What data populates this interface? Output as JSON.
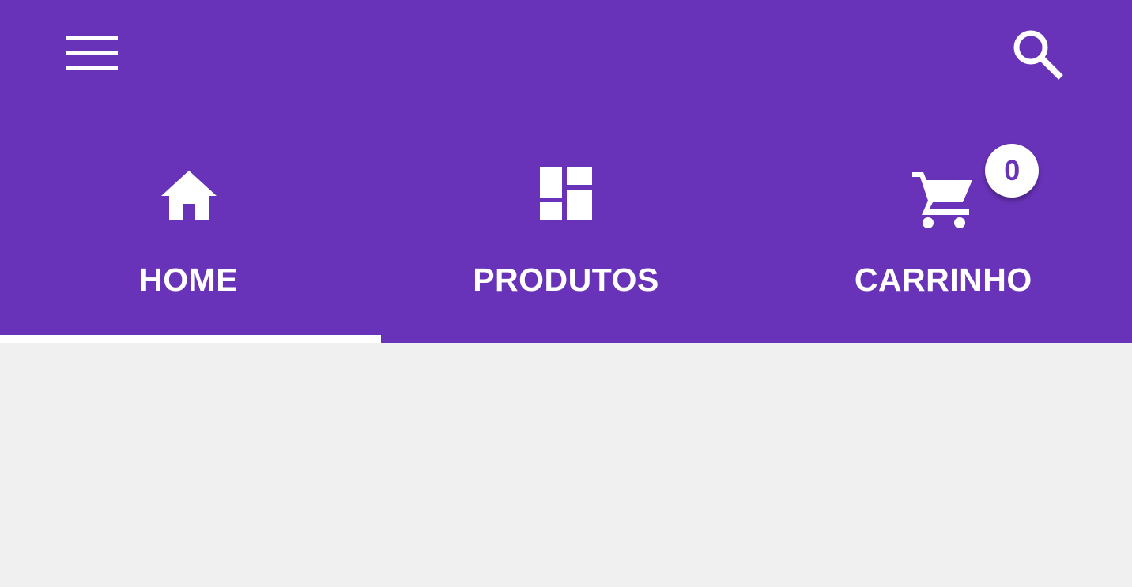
{
  "app_bar": {
    "menu_icon": "hamburger-menu-icon",
    "search_icon": "search-icon",
    "color": "#6833b8"
  },
  "tabs": [
    {
      "label": "HOME",
      "icon": "home-icon",
      "selected": true
    },
    {
      "label": "PRODUTOS",
      "icon": "dashboard-grid-icon",
      "selected": false
    },
    {
      "label": "CARRINHO",
      "icon": "shopping-cart-icon",
      "selected": false
    }
  ],
  "cart": {
    "badge_count": "0"
  },
  "colors": {
    "accent": "#6833b8",
    "indicator": "#ffffff",
    "background": "#f0f0f0"
  }
}
